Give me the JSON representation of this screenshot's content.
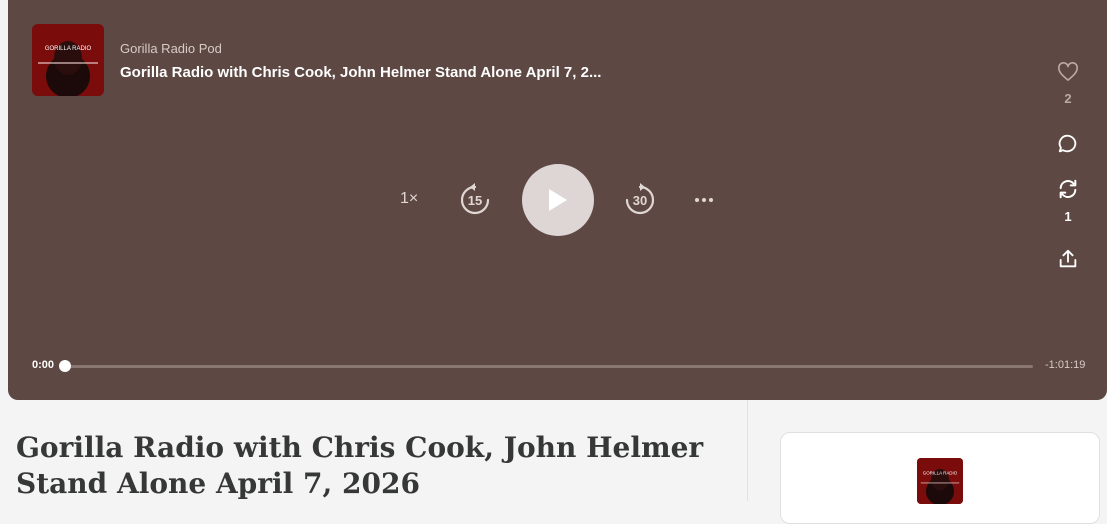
{
  "player": {
    "background": "#5d4843",
    "show_name": "Gorilla Radio Pod",
    "episode_title": "Gorilla Radio with Chris Cook, John Helmer Stand Alone April 7, 2...",
    "cover_text": "GORILLA RADIO",
    "speed_label": "1×",
    "skip_back_label": "15",
    "skip_forward_label": "30",
    "icons": {
      "play": "play-icon",
      "more": "more-icon",
      "like": "heart-icon",
      "comment": "comment-icon",
      "restack": "restack-icon",
      "share": "share-icon"
    },
    "like_count": "2",
    "restack_count": "1",
    "time_elapsed": "0:00",
    "time_remaining": "-1:01:19",
    "progress": 0
  },
  "page": {
    "title_line1": "Gorilla Radio with Chris Cook, John Helmer",
    "title_line2": "Stand Alone April 7, 2026"
  },
  "sidebar_card": {
    "cover_text": "GORILLA RADIO"
  }
}
